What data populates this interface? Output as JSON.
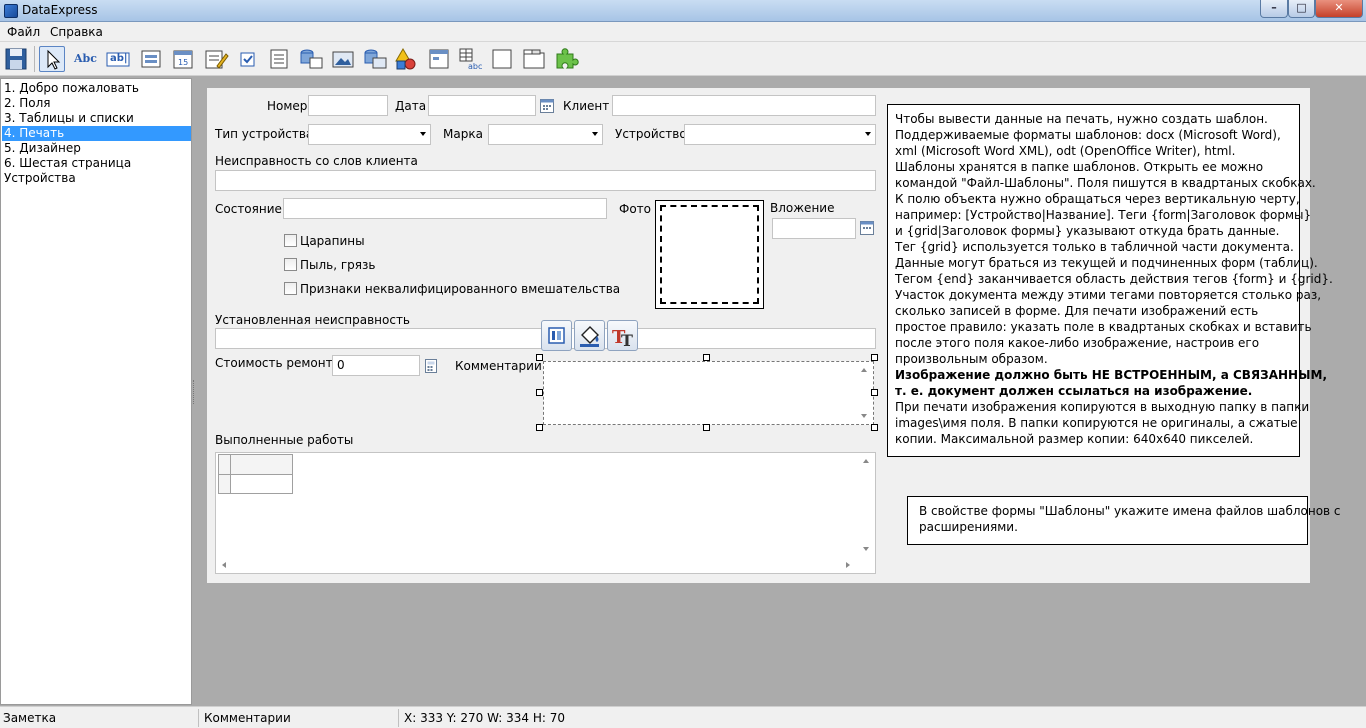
{
  "window": {
    "title": "DataExpress"
  },
  "menu": {
    "file": "Файл",
    "help": "Справка"
  },
  "toolbar": {
    "label_tool": "Abc",
    "text_tool": "ab|"
  },
  "tree": {
    "items": [
      "1. Добро пожаловать",
      "2. Поля",
      "3. Таблицы и списки",
      "4. Печать",
      "5. Дизайнер",
      "6. Шестая страница",
      "Устройства"
    ],
    "selected_index": 3
  },
  "form": {
    "number_label": "Номер",
    "date_label": "Дата",
    "client_label": "Клиент",
    "device_type_label": "Тип устройства",
    "brand_label": "Марка",
    "device_label": "Устройство",
    "fault_client_label": "Неисправность со слов клиента",
    "state_label": "Состояние",
    "photo_label": "Фото",
    "attachment_label": "Вложение",
    "scratches_label": "Царапины",
    "dust_label": "Пыль, грязь",
    "tamper_label": "Признаки неквалифицированного вмешательства",
    "established_fault_label": "Установленная неисправность",
    "repair_cost_label": "Стоимость ремонта",
    "repair_cost_value": "0",
    "comments_label": "Комментарии",
    "works_label": "Выполненные работы"
  },
  "note_main": {
    "lines": [
      "Чтобы вывести данные на печать, нужно создать шаблон.",
      "Поддерживаемые форматы шаблонов: docx (Microsoft Word),",
      "xml (Microsoft Word XML), odt (OpenOffice Writer), html.",
      "Шаблоны хранятся в папке шаблонов. Открыть ее можно",
      "командой \"Файл-Шаблоны\". Поля пишутся в квадртаных скобках.",
      "К полю объекта нужно обращаться через вертикальную черту,",
      "например: [Устройство|Название]. Теги {form|Заголовок формы}",
      "и {grid|Заголовок формы} указывают откуда брать данные.",
      "Тег {grid} используется только в табличной части документа.",
      "Данные могут браться из текущей и подчиненных форм (таблиц).",
      "Тегом {end} заканчивается область действия тегов {form} и {grid}.",
      "Участок документа между этими тегами повторяется столько раз,",
      "сколько записей в форме. Для печати изображений есть",
      "простое правило: указать поле в квадртаных скобках и вставить",
      "после этого поля какое-либо изображение, настроив его",
      "произвольным образом."
    ],
    "bold_lines": [
      "Изображение должно быть НЕ ВСТРОЕННЫМ, а СВЯЗАННЫМ,",
      "т. е. документ должен ссылаться на изображение."
    ],
    "tail_lines": [
      "При печати изображения копируются в выходную папку в папки",
      "images\\имя поля. В папки копируются не оригиналы, а сжатые",
      "копии. Максимальной размер копии: 640x640 пикселей."
    ]
  },
  "note_small": {
    "lines": [
      "В свойстве формы \"Шаблоны\" укажите имена файлов шаблонов с",
      "расширениями."
    ]
  },
  "status": {
    "type": "Заметка",
    "name": "Комментарии",
    "geometry": "X: 333 Y: 270 W: 334 H: 70"
  }
}
